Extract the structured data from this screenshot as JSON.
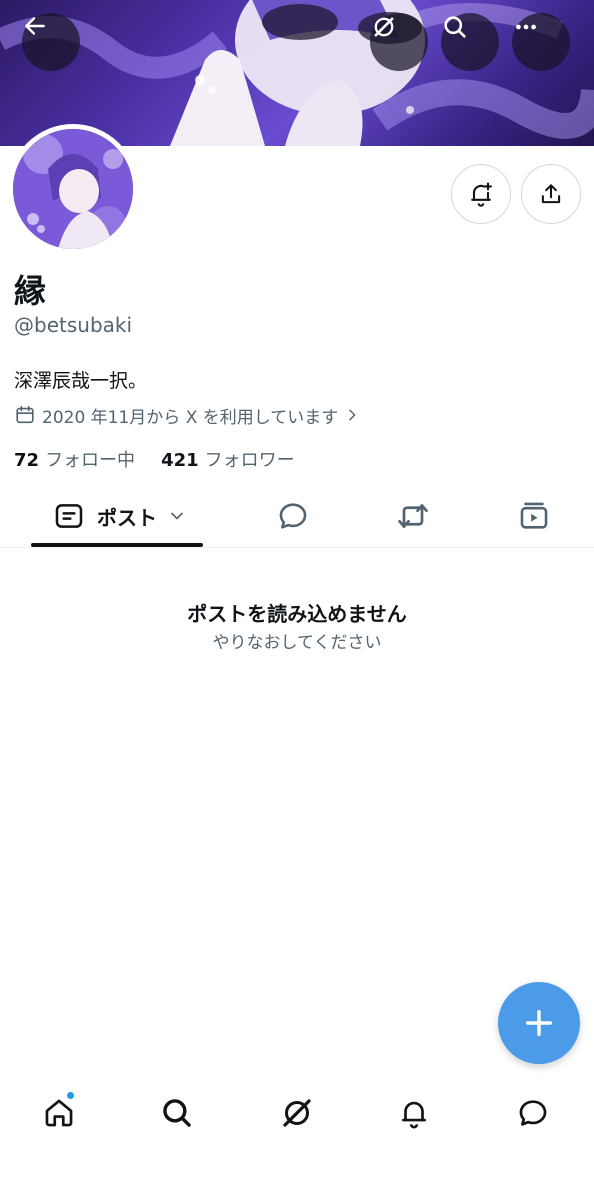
{
  "profile": {
    "name": "縁",
    "handle": "@betsubaki",
    "bio": "深澤辰哉一択。",
    "joined": "2020 年11月から X を利用しています",
    "following_count": "72",
    "following_label": "フォロー中",
    "followers_count": "421",
    "followers_label": "フォロワー"
  },
  "header": {
    "back_icon": "arrow-left-icon",
    "grok_icon": "grok-icon",
    "search_icon": "search-icon",
    "more_icon": "more-icon"
  },
  "actions": {
    "notify_icon": "bell-plus-icon",
    "share_icon": "share-icon"
  },
  "tabs": [
    {
      "label": "ポスト",
      "icon": "posts-icon",
      "active": true
    },
    {
      "icon": "reply-icon"
    },
    {
      "icon": "repost-icon"
    },
    {
      "icon": "media-icon"
    }
  ],
  "empty_state": {
    "title": "ポストを読み込めません",
    "subtitle": "やりなおしてください"
  },
  "fab_icon": "plus-icon",
  "bottom_nav": [
    {
      "icon": "home-icon",
      "dot": true
    },
    {
      "icon": "search-icon"
    },
    {
      "icon": "grok-icon"
    },
    {
      "icon": "bell-icon"
    },
    {
      "icon": "messages-icon"
    }
  ],
  "colors": {
    "accent": "#4c9be8",
    "text_primary": "#0f1419",
    "text_secondary": "#536471",
    "border": "#cfd9de",
    "notification_dot": "#1d9bf0"
  }
}
